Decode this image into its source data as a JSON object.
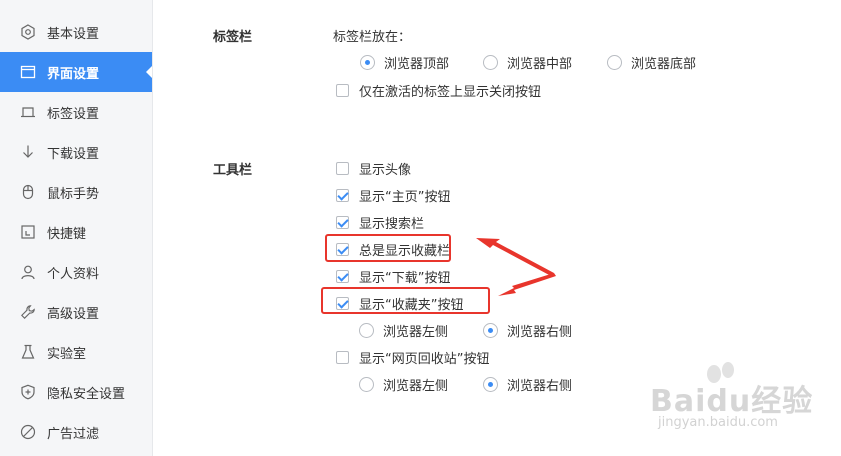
{
  "sidebar": {
    "items": [
      {
        "label": "基本设置",
        "icon": "hexagon-gear-icon"
      },
      {
        "label": "界面设置",
        "icon": "window-icon",
        "active": true
      },
      {
        "label": "标签设置",
        "icon": "tab-icon"
      },
      {
        "label": "下载设置",
        "icon": "download-arrow-icon"
      },
      {
        "label": "鼠标手势",
        "icon": "mouse-icon"
      },
      {
        "label": "快捷键",
        "icon": "shortcut-icon"
      },
      {
        "label": "个人资料",
        "icon": "person-icon"
      },
      {
        "label": "高级设置",
        "icon": "wrench-icon"
      },
      {
        "label": "实验室",
        "icon": "flask-icon"
      },
      {
        "label": "隐私安全设置",
        "icon": "shield-icon"
      },
      {
        "label": "广告过滤",
        "icon": "block-icon"
      }
    ]
  },
  "tabbar": {
    "title": "标签栏",
    "position_label": "标签栏放在：",
    "options": [
      {
        "label": "浏览器顶部",
        "checked": true
      },
      {
        "label": "浏览器中部",
        "checked": false
      },
      {
        "label": "浏览器底部",
        "checked": false
      }
    ],
    "close_only_active": {
      "label": "仅在激活的标签上显示关闭按钮",
      "checked": false
    }
  },
  "toolbar": {
    "title": "工具栏",
    "items": [
      {
        "label": "显示头像",
        "checked": false
      },
      {
        "label": "显示“主页”按钮",
        "checked": true
      },
      {
        "label": "显示搜索栏",
        "checked": true
      },
      {
        "label": "总是显示收藏栏",
        "checked": true
      },
      {
        "label": "显示“下载”按钮",
        "checked": true
      },
      {
        "label": "显示“收藏夹”按钮",
        "checked": true
      }
    ],
    "favorites_position": [
      {
        "label": "浏览器左侧",
        "checked": false
      },
      {
        "label": "浏览器右侧",
        "checked": true
      }
    ],
    "recycle": {
      "label": "显示“网页回收站”按钮",
      "checked": false
    },
    "recycle_position": [
      {
        "label": "浏览器左侧",
        "checked": false
      },
      {
        "label": "浏览器右侧",
        "checked": true
      }
    ]
  },
  "colors": {
    "accent": "#3b8cf4",
    "annotation": "#e8352c",
    "sidebar_bg": "#f5f6f8"
  },
  "watermark": {
    "main": "Baidu经验",
    "sub": "jingyan.baidu.com"
  }
}
